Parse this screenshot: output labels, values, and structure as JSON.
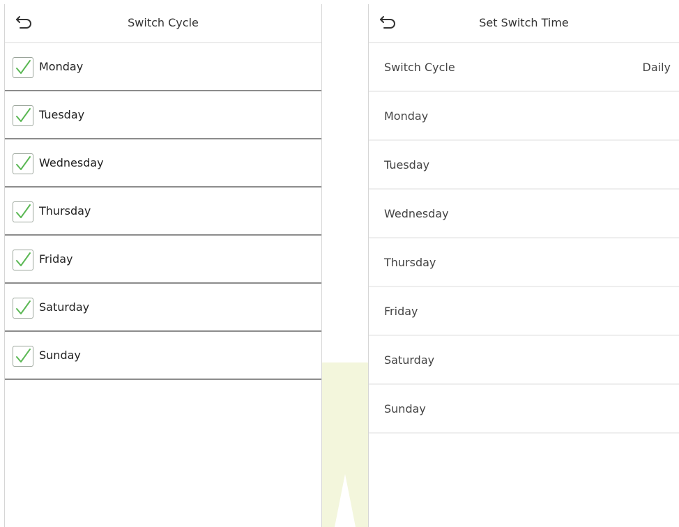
{
  "colors": {
    "check": "#5bb854",
    "watermark": "#f3f6dc"
  },
  "left_screen": {
    "title": "Switch Cycle",
    "back_icon": "back-arrow-icon",
    "days": [
      {
        "label": "Monday",
        "checked": true
      },
      {
        "label": "Tuesday",
        "checked": true
      },
      {
        "label": "Wednesday",
        "checked": true
      },
      {
        "label": "Thursday",
        "checked": true
      },
      {
        "label": "Friday",
        "checked": true
      },
      {
        "label": "Saturday",
        "checked": true
      },
      {
        "label": "Sunday",
        "checked": true
      }
    ]
  },
  "right_screen": {
    "title": "Set Switch Time",
    "back_icon": "back-arrow-icon",
    "switch_cycle": {
      "label": "Switch Cycle",
      "value": "Daily"
    },
    "days": [
      {
        "label": "Monday"
      },
      {
        "label": "Tuesday"
      },
      {
        "label": "Wednesday"
      },
      {
        "label": "Thursday"
      },
      {
        "label": "Friday"
      },
      {
        "label": "Saturday"
      },
      {
        "label": "Sunday"
      }
    ]
  }
}
